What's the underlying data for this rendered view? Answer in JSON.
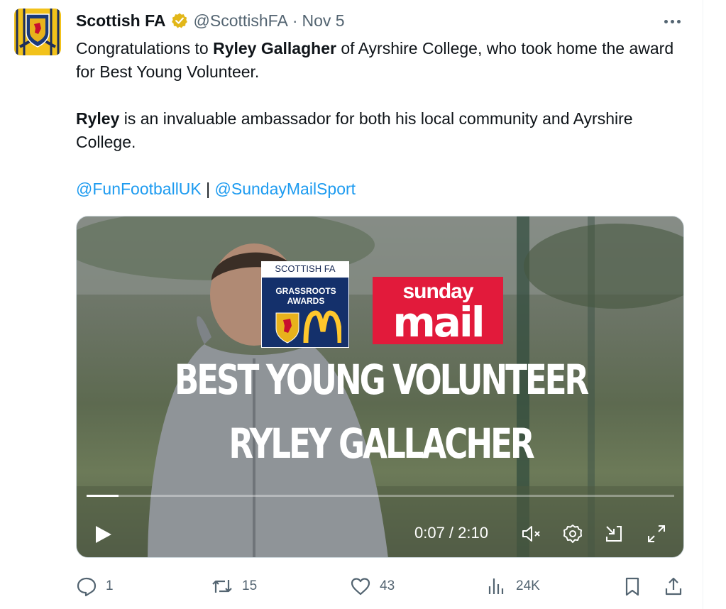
{
  "tweet": {
    "author_name": "Scottish FA",
    "handle": "@ScottishFA",
    "separator": "·",
    "date": "Nov 5",
    "text": {
      "p1_a": "Congratulations to ",
      "p1_bold": "Ryley Gallagher",
      "p1_b": " of Ayrshire College, who took home the award for Best Young Volunteer.",
      "p2_bold": "Ryley",
      "p2_b": " is an invaluable ambassador for both his local community and Ayrshire College.",
      "mention1": "@FunFootballUK",
      "mention_sep": " | ",
      "mention2": "@SundayMailSport"
    }
  },
  "media": {
    "badge_top": "SCOTTISH FA",
    "badge_line1": "GRASSROOTS",
    "badge_line2": "AWARDS",
    "mail_word1": "sunday",
    "mail_word2": "mail",
    "headline1": "BEST YOUNG VOLUNTEER",
    "headline2": "RYLEY GALLACHER",
    "time": "0:07 / 2:10",
    "progress": 0.054
  },
  "actions": {
    "replies": "1",
    "retweets": "15",
    "likes": "43",
    "views": "24K"
  },
  "icons": {
    "verified": "verified-gold-badge-icon",
    "more": "more-icon",
    "play": "play-icon",
    "mute": "mute-icon",
    "settings": "settings-icon",
    "pip": "picture-in-picture-icon",
    "fullscreen": "fullscreen-icon",
    "reply": "reply-icon",
    "retweet": "retweet-icon",
    "like": "like-icon",
    "views": "views-icon",
    "bookmark": "bookmark-icon",
    "share": "share-icon"
  },
  "colors": {
    "link": "#1d9bf0",
    "secondary": "#536471",
    "verified": "#e2b719",
    "mail": "#e21a3b"
  }
}
